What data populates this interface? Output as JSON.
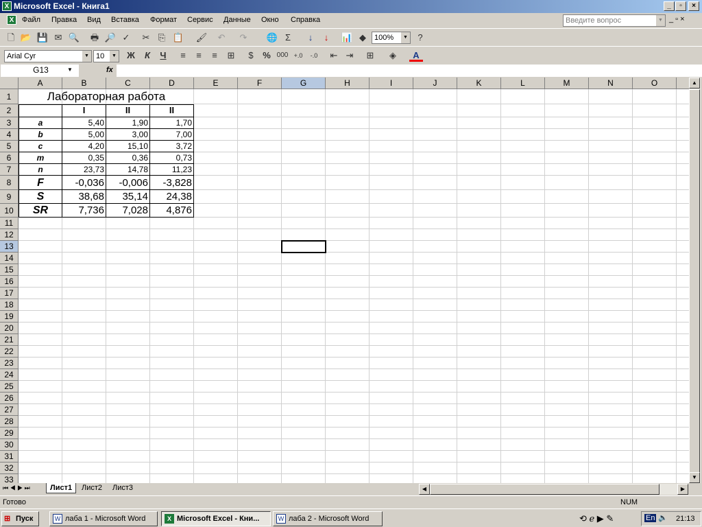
{
  "window": {
    "title": "Microsoft Excel - Книга1"
  },
  "menu": [
    "Файл",
    "Правка",
    "Вид",
    "Вставка",
    "Формат",
    "Сервис",
    "Данные",
    "Окно",
    "Справка"
  ],
  "help_search": {
    "placeholder": "Введите вопрос"
  },
  "toolbar": {
    "zoom": "100%",
    "font": "Arial Cyr",
    "size": "10",
    "bold": "Ж",
    "italic": "К",
    "underline": "Ч",
    "percent": "%",
    "thousands": "000"
  },
  "formula_bar": {
    "name_box": "G13",
    "fx": "fx",
    "value": ""
  },
  "columns": [
    "A",
    "B",
    "C",
    "D",
    "E",
    "F",
    "G",
    "H",
    "I",
    "J",
    "K",
    "L",
    "M",
    "N",
    "O"
  ],
  "selected_cell": "G13",
  "sheet": {
    "title": "Лабораторная работа",
    "headers": [
      "I",
      "II",
      "II"
    ],
    "rows": [
      {
        "label": "a",
        "values": [
          "5,40",
          "1,90",
          "1,70"
        ]
      },
      {
        "label": "b",
        "values": [
          "5,00",
          "3,00",
          "7,00"
        ]
      },
      {
        "label": "c",
        "values": [
          "4,20",
          "15,10",
          "3,72"
        ]
      },
      {
        "label": "m",
        "values": [
          "0,35",
          "0,36",
          "0,73"
        ]
      },
      {
        "label": "n",
        "values": [
          "23,73",
          "14,78",
          "11,23"
        ]
      },
      {
        "label": "F",
        "values": [
          "-0,036",
          "-0,006",
          "-3,828"
        ]
      },
      {
        "label": "S",
        "values": [
          "38,68",
          "35,14",
          "24,38"
        ]
      },
      {
        "label": "SR",
        "values": [
          "7,736",
          "7,028",
          "4,876"
        ]
      }
    ]
  },
  "sheet_tabs": [
    "Лист1",
    "Лист2",
    "Лист3"
  ],
  "status": {
    "ready": "Готово",
    "num": "NUM"
  },
  "taskbar": {
    "start": "Пуск",
    "tasks": [
      "лаба 1 - Microsoft Word",
      "Microsoft Excel - Кни...",
      "лаба 2 - Microsoft Word"
    ],
    "lang": "En",
    "clock": "21:13"
  }
}
